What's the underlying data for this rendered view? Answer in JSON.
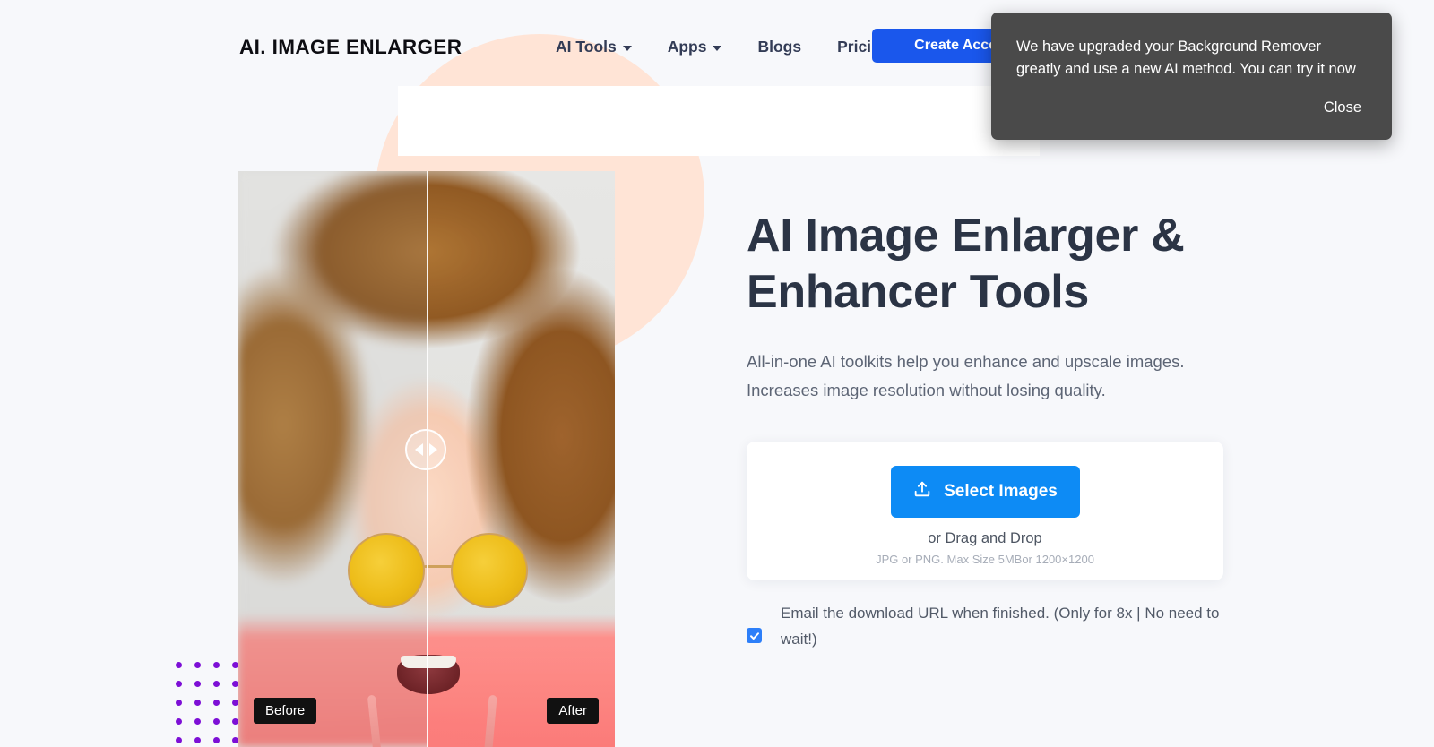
{
  "brand": {
    "logo_text": "AI. IMAGE ENLARGER"
  },
  "nav": {
    "items": [
      {
        "label": "AI Tools",
        "has_dropdown": true
      },
      {
        "label": "Apps",
        "has_dropdown": true
      },
      {
        "label": "Blogs",
        "has_dropdown": false
      },
      {
        "label": "Pricing",
        "has_dropdown": false
      }
    ],
    "cta_label": "Create Account"
  },
  "toast": {
    "message": "We have upgraded your Background Remover greatly and use a new AI method. You can try it now",
    "close_label": "Close",
    "background_color": "#4a4a4a"
  },
  "comparison": {
    "before_label": "Before",
    "after_label": "After",
    "handle_icon": "left-right-arrows-icon",
    "slider_position_percent": 50
  },
  "hero": {
    "title": "AI Image Enlarger & Enhancer Tools",
    "subtitle": "All-in-one AI toolkits help you enhance and upscale images. Increases image resolution without losing quality."
  },
  "upload": {
    "button_label": "Select Images",
    "button_icon": "upload-icon",
    "button_color": "#0d8bf5",
    "drag_text": "or Drag and Drop",
    "limits_text": "JPG or PNG. Max Size 5MBor 1200×1200"
  },
  "email_option": {
    "label": "Email the download URL when finished. (Only for 8x | No need to wait!)",
    "checked": true,
    "accent_color": "#2d7ff9"
  },
  "decor": {
    "circle_color": "#ffe4d6",
    "dot_color": "#7d0fd6",
    "page_background": "#f7f8fb"
  }
}
